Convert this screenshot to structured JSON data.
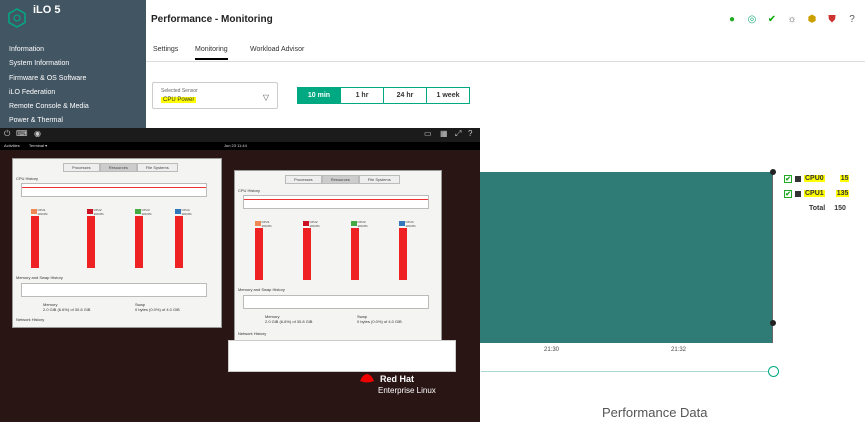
{
  "app": {
    "brand": "iLO 5"
  },
  "sidebar": {
    "items": [
      "Information",
      "System Information",
      "Firmware & OS Software",
      "iLO Federation",
      "Remote Console & Media",
      "Power & Thermal"
    ]
  },
  "header": {
    "title": "Performance - Monitoring"
  },
  "tabs": [
    "Settings",
    "Monitoring",
    "Workload Advisor"
  ],
  "sensor": {
    "label": "Selected Sensor",
    "value": "CPU Power"
  },
  "ranges": [
    "10 min",
    "1 hr",
    "24 hr",
    "1 week"
  ],
  "chart_data": {
    "type": "area",
    "title": "Performance Data",
    "x": [
      "21:30",
      "21:32"
    ],
    "series": [
      {
        "name": "CPU0",
        "values": [
          15
        ]
      },
      {
        "name": "CPU1",
        "values": [
          135
        ]
      }
    ],
    "legend": [
      {
        "name": "CPU0",
        "value": "15"
      },
      {
        "name": "CPU1",
        "value": "135"
      }
    ],
    "total_label": "Total",
    "total": "150"
  },
  "terminal": {
    "activities": "Activities",
    "terminal_label": "Terminal ▾",
    "clock": "Jun 23 11:44",
    "rh_brand": "Red Hat",
    "rh_product": "Enterprise Linux",
    "sysmon_tabs": [
      "Processes",
      "Resources",
      "File Systems"
    ],
    "cpu_history": "CPU History",
    "mem_history": "Memory and Swap History",
    "net_history": "Network History",
    "memory_label": "Memory",
    "memory_value": "2.0 GiB (6.6%) of 30.8 GiB",
    "swap_label": "Swap",
    "swap_value": "0 bytes (0.0%) of 4.0 GiB",
    "cpu_entries": [
      "CPU1 100.0%",
      "CPU2 100.0%",
      "CPU3 100.0%",
      "CPU4 100.0%"
    ]
  },
  "colors": {
    "accent": "#01a982",
    "sidebar": "#425563",
    "chart": "#2f7c77"
  }
}
